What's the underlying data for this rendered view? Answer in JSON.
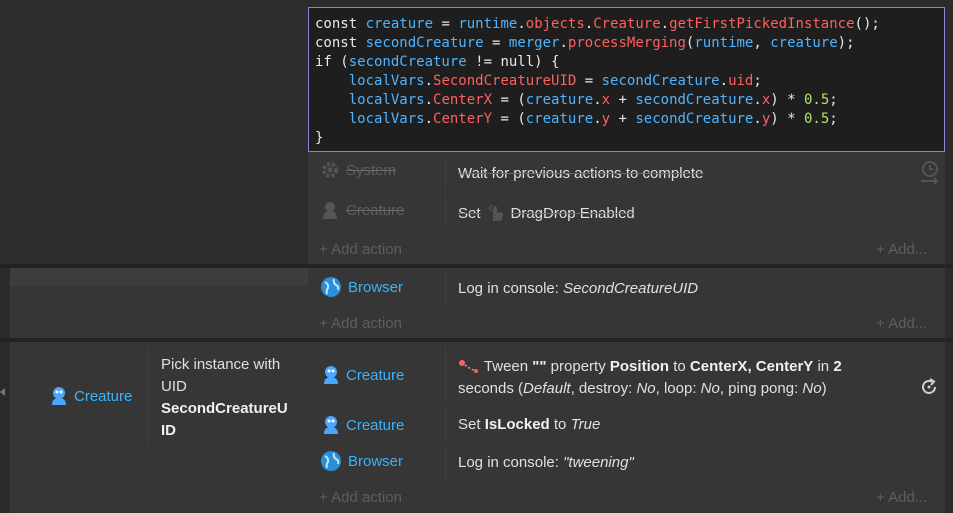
{
  "code": {
    "lines": [
      [
        [
          "kw",
          "const "
        ],
        [
          "id",
          "creature"
        ],
        [
          "kw",
          " = "
        ],
        [
          "id",
          "runtime"
        ],
        [
          "kw",
          "."
        ],
        [
          "prop",
          "objects"
        ],
        [
          "kw",
          "."
        ],
        [
          "prop",
          "Creature"
        ],
        [
          "kw",
          "."
        ],
        [
          "prop",
          "getFirstPickedInstance"
        ],
        [
          "kw",
          "();"
        ]
      ],
      [
        [
          "kw",
          "const "
        ],
        [
          "id",
          "secondCreature"
        ],
        [
          "kw",
          " = "
        ],
        [
          "id",
          "merger"
        ],
        [
          "kw",
          "."
        ],
        [
          "prop",
          "processMerging"
        ],
        [
          "kw",
          "("
        ],
        [
          "id",
          "runtime"
        ],
        [
          "kw",
          ", "
        ],
        [
          "id",
          "creature"
        ],
        [
          "kw",
          ");"
        ]
      ],
      [
        [
          "kw",
          "if ("
        ],
        [
          "id",
          "secondCreature"
        ],
        [
          "kw",
          " != null) {"
        ]
      ],
      [
        [
          "kw",
          "    "
        ],
        [
          "id",
          "localVars"
        ],
        [
          "kw",
          "."
        ],
        [
          "prop",
          "SecondCreatureUID"
        ],
        [
          "kw",
          " = "
        ],
        [
          "id",
          "secondCreature"
        ],
        [
          "kw",
          "."
        ],
        [
          "prop",
          "uid"
        ],
        [
          "kw",
          ";"
        ]
      ],
      [
        [
          "kw",
          "    "
        ],
        [
          "id",
          "localVars"
        ],
        [
          "kw",
          "."
        ],
        [
          "prop",
          "CenterX"
        ],
        [
          "kw",
          " = ("
        ],
        [
          "id",
          "creature"
        ],
        [
          "kw",
          "."
        ],
        [
          "prop",
          "x"
        ],
        [
          "kw",
          " + "
        ],
        [
          "id",
          "secondCreature"
        ],
        [
          "kw",
          "."
        ],
        [
          "prop",
          "x"
        ],
        [
          "kw",
          ") * "
        ],
        [
          "num",
          "0.5"
        ],
        [
          "kw",
          ";"
        ]
      ],
      [
        [
          "kw",
          "    "
        ],
        [
          "id",
          "localVars"
        ],
        [
          "kw",
          "."
        ],
        [
          "prop",
          "CenterY"
        ],
        [
          "kw",
          " = ("
        ],
        [
          "id",
          "creature"
        ],
        [
          "kw",
          "."
        ],
        [
          "prop",
          "y"
        ],
        [
          "kw",
          " + "
        ],
        [
          "id",
          "secondCreature"
        ],
        [
          "kw",
          "."
        ],
        [
          "prop",
          "y"
        ],
        [
          "kw",
          ") * "
        ],
        [
          "num",
          "0.5"
        ],
        [
          "kw",
          ";"
        ]
      ],
      [
        [
          "kw",
          "}"
        ]
      ]
    ]
  },
  "disabled_actions": [
    {
      "object": "System",
      "text": "Wait for previous actions to complete"
    },
    {
      "object": "Creature",
      "text_prefix": "Set",
      "text_suffix": "DragDrop Enabled"
    }
  ],
  "add_action_label": "+ Add action",
  "add_more_label": "+ Add...",
  "browser_block": {
    "object": "Browser",
    "action_prefix": "Log in console: ",
    "action_value": "SecondCreatureUID"
  },
  "event_block": {
    "condition_object": "Creature",
    "condition_text_1": "Pick instance with",
    "condition_text_2": "UID",
    "condition_value_1": "SecondCreatureU",
    "condition_value_2": "ID",
    "actions": {
      "tween_object": "Creature",
      "tween_line1_a": "Tween ",
      "tween_line1_b": "\"\"",
      "tween_line1_c": " property ",
      "tween_line1_d": "Position",
      "tween_line1_e": " to ",
      "tween_line1_f": "CenterX, CenterY",
      "tween_line1_g": " in ",
      "tween_line1_h": "2",
      "tween_line2_a": "seconds (",
      "tween_line2_b": "Default",
      "tween_line2_c": ", destroy: ",
      "tween_line2_d": "No",
      "tween_line2_e": ", loop: ",
      "tween_line2_f": "No",
      "tween_line2_g": ", ping pong: ",
      "tween_line2_h": "No",
      "tween_line2_i": ")",
      "set_object": "Creature",
      "set_a": "Set ",
      "set_b": "IsLocked",
      "set_c": " to ",
      "set_d": "True",
      "log_object": "Browser",
      "log_a": "Log in console: ",
      "log_b": "\"tweening\""
    }
  },
  "icons": {
    "system": "gear-icon",
    "creature": "creature-icon",
    "browser": "globe-icon",
    "wait": "clock-arrow-icon",
    "drag": "drag-hand-icon",
    "tween": "tween-icon",
    "refresh": "loop-icon"
  },
  "colors": {
    "accent": "#3ab3ff",
    "code_border": "#8c83d9",
    "code_string": "#ff5f5f",
    "code_identifier": "#4fb4ff",
    "code_number": "#b5e36b"
  }
}
